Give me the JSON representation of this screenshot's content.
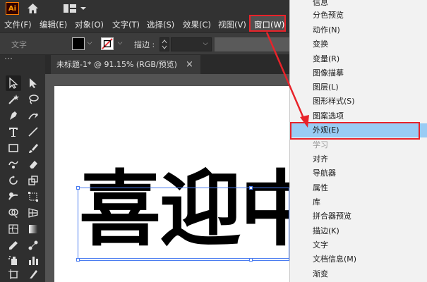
{
  "app": {
    "logo": "Ai",
    "home_icon": "home-icon",
    "layout_icon": "workspace-layout-icon"
  },
  "menubar": {
    "items": [
      "文件(F)",
      "编辑(E)",
      "对象(O)",
      "文字(T)",
      "选择(S)",
      "效果(C)",
      "视图(V)",
      "窗口(W)"
    ]
  },
  "controlbar": {
    "mode_label": "文字",
    "stroke_label": "描边 :",
    "fill_color": "#000000",
    "stroke_none_color": "#e8232a"
  },
  "document": {
    "tab_title": "未标题-1* @ 91.15% (RGB/预览)",
    "close": "×",
    "text": "喜迎中"
  },
  "window_menu": {
    "items": [
      {
        "label": "信息",
        "state": "normal"
      },
      {
        "label": "分色预览",
        "state": "normal"
      },
      {
        "label": "动作(N)",
        "state": "normal"
      },
      {
        "label": "变换",
        "state": "normal"
      },
      {
        "label": "变量(R)",
        "state": "normal"
      },
      {
        "label": "图像描摹",
        "state": "normal"
      },
      {
        "label": "图层(L)",
        "state": "normal"
      },
      {
        "label": "图形样式(S)",
        "state": "normal"
      },
      {
        "label": "图案选项",
        "state": "normal"
      },
      {
        "label": "外观(E)",
        "state": "highlight"
      },
      {
        "label": "学习",
        "state": "disabled"
      },
      {
        "label": "对齐",
        "state": "normal"
      },
      {
        "label": "导航器",
        "state": "normal"
      },
      {
        "label": "属性",
        "state": "normal"
      },
      {
        "label": "库",
        "state": "normal"
      },
      {
        "label": "拼合器预览",
        "state": "normal"
      },
      {
        "label": "描边(K)",
        "state": "normal"
      },
      {
        "label": "文字",
        "state": "normal"
      },
      {
        "label": "文档信息(M)",
        "state": "normal"
      },
      {
        "label": "渐变",
        "state": "normal"
      }
    ]
  },
  "colors": {
    "annotation_red": "#e8232a",
    "menu_highlight": "#99ccf4",
    "selection_blue": "#4a7cf0"
  }
}
